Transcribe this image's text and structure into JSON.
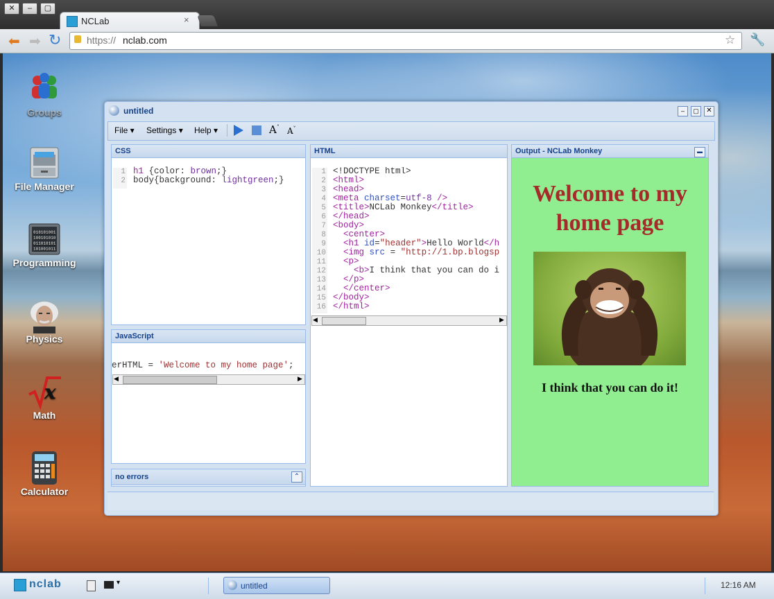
{
  "browser": {
    "tab_title": "NCLab",
    "url_scheme": "https://",
    "url_host": "nclab.com"
  },
  "desktop": {
    "icons": [
      {
        "label": "Groups",
        "icon": "groups-icon"
      },
      {
        "label": "File Manager",
        "icon": "file-cabinet-icon"
      },
      {
        "label": "Programming",
        "icon": "binary-screen-icon"
      },
      {
        "label": "Physics",
        "icon": "einstein-icon"
      },
      {
        "label": "Math",
        "icon": "sqrt-x-icon"
      },
      {
        "label": "Calculator",
        "icon": "calculator-icon"
      }
    ]
  },
  "window": {
    "title": "untitled",
    "menu": {
      "file": "File",
      "settings": "Settings",
      "help": "Help"
    },
    "css_panel": {
      "title": "CSS",
      "lines": [
        "h1 {color: brown;}",
        "body{background: lightgreen;}"
      ]
    },
    "js_panel": {
      "title": "JavaScript",
      "line_pre": "erHTML = ",
      "line_str": "'Welcome to my home page'",
      "line_post": ";"
    },
    "status_panel": {
      "title": "no errors"
    },
    "html_panel": {
      "title": "HTML",
      "line_numbers": "1\n2\n3\n4\n5\n6\n7\n8\n9\n10\n11\n12\n13\n14\n15\n16"
    },
    "output_panel": {
      "title": "Output - NCLab Monkey",
      "heading": "Welcome to my home page",
      "text": "I think that you can do it!"
    }
  },
  "taskbar": {
    "logo": "nclab",
    "task_label": "untitled",
    "clock": "12:16 AM"
  },
  "colors": {
    "output_bg": "#90ee90",
    "heading_color": "#a52a2a",
    "panel_header_text": "#15428b"
  }
}
